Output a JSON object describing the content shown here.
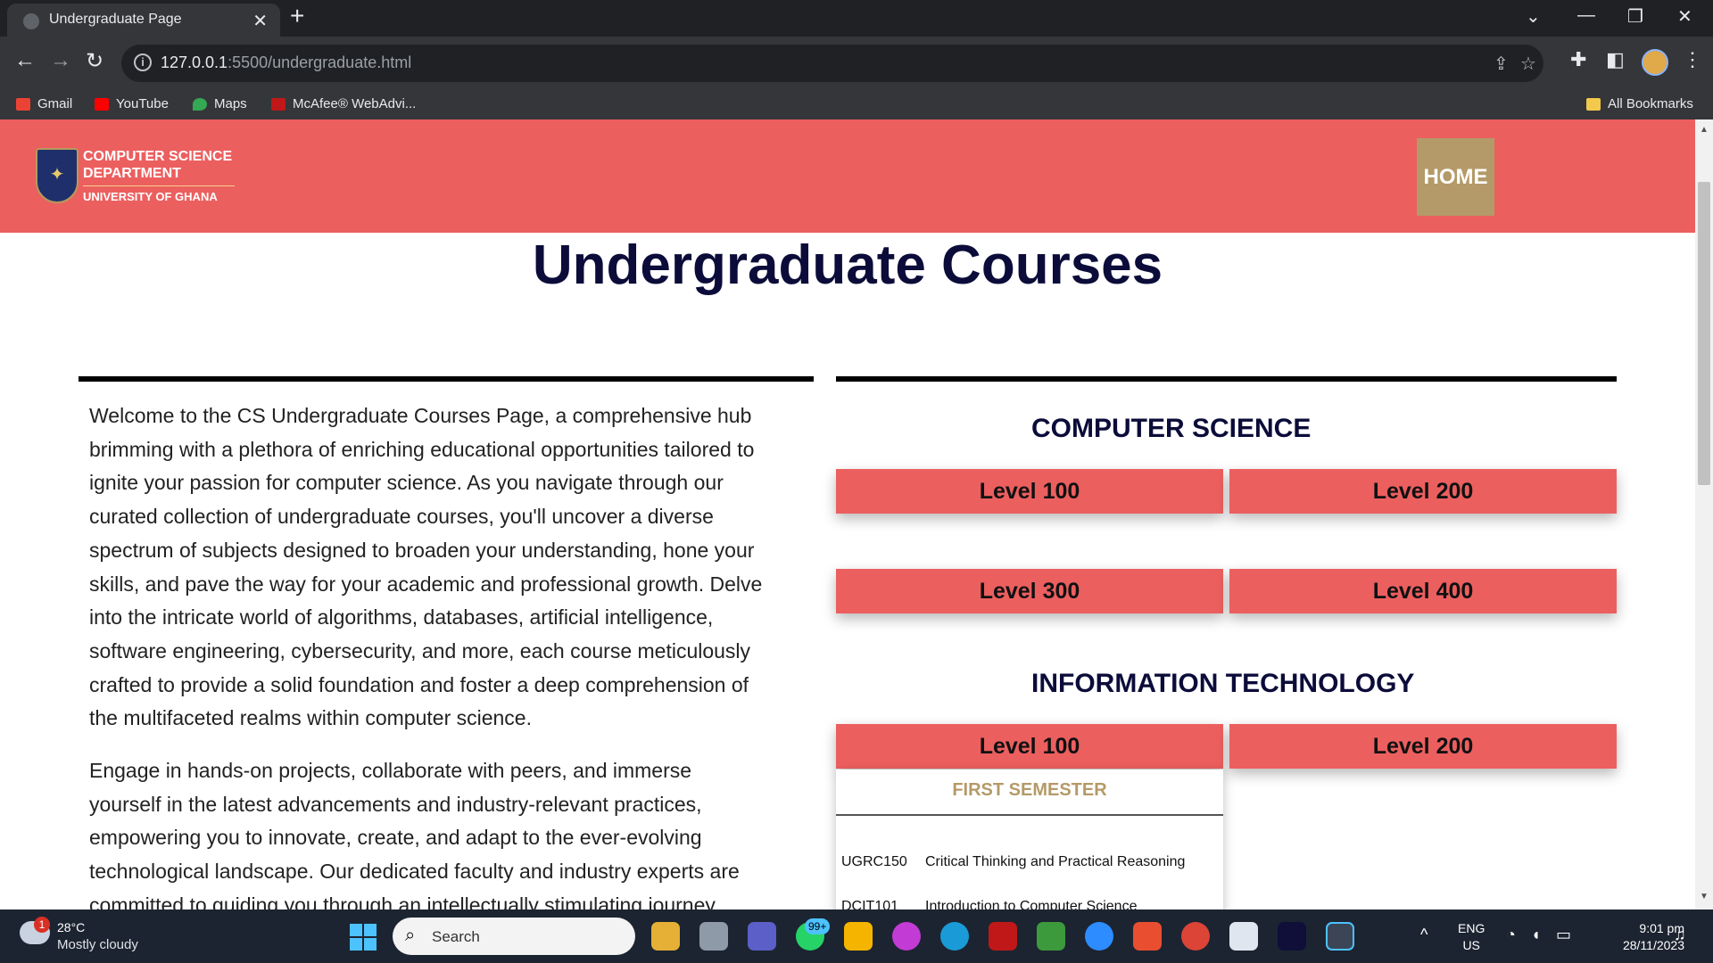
{
  "browser": {
    "tab_title": "Undergraduate Page",
    "tab_close": "✕",
    "new_tab": "+",
    "url_host": "127.0.0.1",
    "url_path": ":5500/undergraduate.html",
    "bookmarks": [
      "Gmail",
      "YouTube",
      "Maps",
      "McAfee® WebAdvi..."
    ],
    "all_bookmarks": "All Bookmarks"
  },
  "site": {
    "logo_line1": "COMPUTER SCIENCE",
    "logo_line2": "DEPARTMENT",
    "logo_line3": "UNIVERSITY OF GHANA",
    "home_label": "HOME"
  },
  "page": {
    "title": "Undergraduate Courses",
    "intro_paragraphs": [
      "Welcome to the CS Undergraduate Courses Page, a comprehensive hub brimming with a plethora of enriching educational opportunities tailored to ignite your passion for computer science. As you navigate through our curated collection of undergraduate courses, you'll uncover a diverse spectrum of subjects designed to broaden your understanding, hone your skills, and pave the way for your academic and professional growth. Delve into the intricate world of algorithms, databases, artificial intelligence, software engineering, cybersecurity, and more, each course meticulously crafted to provide a solid foundation and foster a deep comprehension of the multifaceted realms within computer science.",
      "Engage in hands-on projects, collaborate with peers, and immerse yourself in the latest advancements and industry-relevant practices, empowering you to innovate, create, and adapt to the ever-evolving technological landscape. Our dedicated faculty and industry experts are committed to guiding you through an intellectually stimulating journey"
    ]
  },
  "programs": {
    "cs": {
      "title": "COMPUTER SCIENCE",
      "levels": [
        "Level 100",
        "Level 200",
        "Level 300",
        "Level 400"
      ]
    },
    "it": {
      "title": "INFORMATION TECHNOLOGY",
      "levels": [
        "Level 100",
        "Level 200"
      ],
      "semester_title": "FIRST SEMESTER",
      "courses": [
        {
          "code": "UGRC150",
          "name": "Critical Thinking and Practical Reasoning"
        },
        {
          "code": "DCIT101",
          "name": "Introduction to Computer Science"
        }
      ]
    }
  },
  "taskbar": {
    "weather_temp": "28°C",
    "weather_desc": "Mostly cloudy",
    "weather_badge": "1",
    "search_label": "Search",
    "notif_badge": "99+",
    "lang_line1": "ENG",
    "lang_line2": "US",
    "time": "9:01 pm",
    "date": "28/11/2023"
  },
  "colors": {
    "header": "#ec5f5f",
    "home_button": "#b49a68",
    "title": "#0c0c3a",
    "semester": "#b49a68"
  }
}
